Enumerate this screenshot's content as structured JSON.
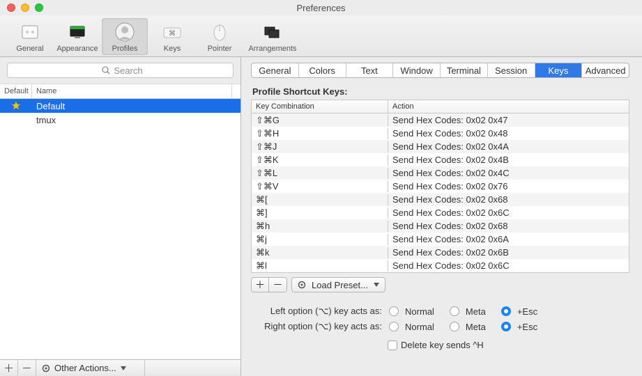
{
  "window": {
    "title": "Preferences"
  },
  "toolbar": [
    {
      "id": "general",
      "label": "General"
    },
    {
      "id": "appearance",
      "label": "Appearance"
    },
    {
      "id": "profiles",
      "label": "Profiles"
    },
    {
      "id": "keys",
      "label": "Keys"
    },
    {
      "id": "pointer",
      "label": "Pointer"
    },
    {
      "id": "arrangements",
      "label": "Arrangements"
    }
  ],
  "toolbar_active": "profiles",
  "left": {
    "search_placeholder": "Search",
    "headers": {
      "default": "Default",
      "name": "Name"
    },
    "profiles": [
      {
        "name": "Default",
        "is_default": true,
        "selected": true
      },
      {
        "name": "tmux",
        "is_default": false,
        "selected": false
      }
    ],
    "other_actions_label": "Other Actions..."
  },
  "right": {
    "tabs": [
      "General",
      "Colors",
      "Text",
      "Window",
      "Terminal",
      "Session",
      "Keys",
      "Advanced"
    ],
    "tabs_active": "Keys",
    "section_title": "Profile Shortcut Keys:",
    "table_headers": {
      "key": "Key Combination",
      "action": "Action"
    },
    "rows": [
      {
        "key": "⇧⌘G",
        "action": "Send Hex Codes: 0x02 0x47"
      },
      {
        "key": "⇧⌘H",
        "action": "Send Hex Codes: 0x02 0x48"
      },
      {
        "key": "⇧⌘J",
        "action": "Send Hex Codes: 0x02 0x4A"
      },
      {
        "key": "⇧⌘K",
        "action": "Send Hex Codes: 0x02 0x4B"
      },
      {
        "key": "⇧⌘L",
        "action": "Send Hex Codes: 0x02 0x4C"
      },
      {
        "key": "⇧⌘V",
        "action": "Send Hex Codes: 0x02 0x76"
      },
      {
        "key": "⌘[",
        "action": "Send Hex Codes: 0x02 0x68"
      },
      {
        "key": "⌘]",
        "action": "Send Hex Codes: 0x02 0x6C"
      },
      {
        "key": "⌘h",
        "action": "Send Hex Codes: 0x02 0x68"
      },
      {
        "key": "⌘j",
        "action": "Send Hex Codes: 0x02 0x6A"
      },
      {
        "key": "⌘k",
        "action": "Send Hex Codes: 0x02 0x6B"
      },
      {
        "key": "⌘l",
        "action": "Send Hex Codes: 0x02 0x6C"
      }
    ],
    "load_preset_label": "Load Preset...",
    "left_option_label": "Left option (⌥) key acts as:",
    "right_option_label": "Right option (⌥) key acts as:",
    "radio_normal": "Normal",
    "radio_meta": "Meta",
    "radio_esc": "+Esc",
    "left_option_value": "+Esc",
    "right_option_value": "+Esc",
    "delete_key_label": "Delete key sends ^H",
    "delete_key_checked": false
  }
}
